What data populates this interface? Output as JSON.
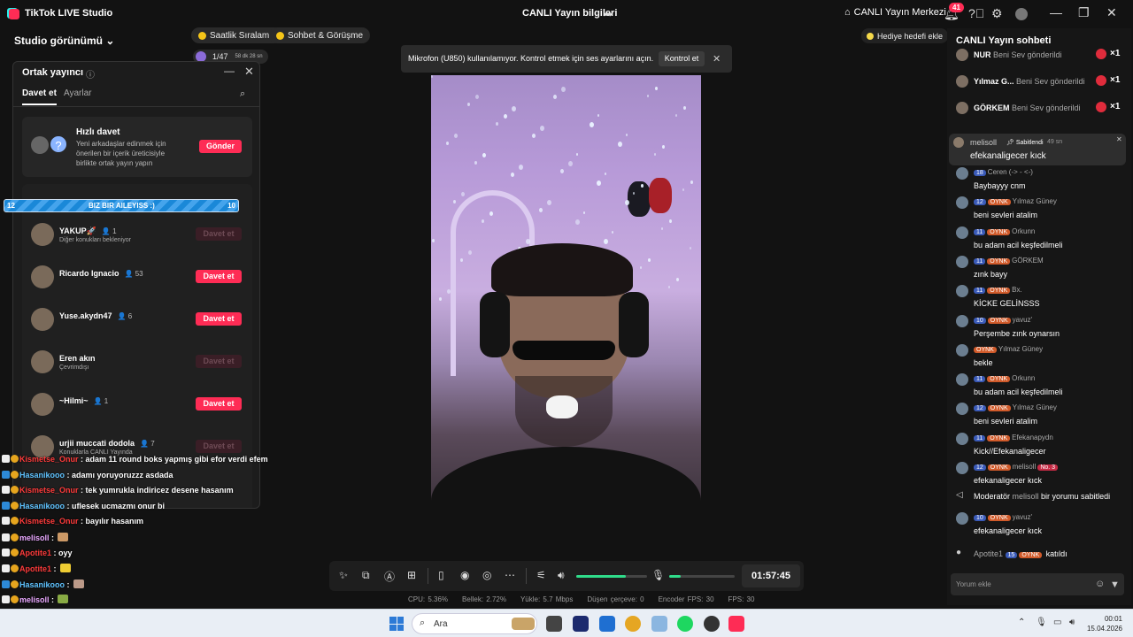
{
  "titlebar": {
    "app_title": "TikTok LIVE Studio",
    "live_info": "CANLI Yayın bilgileri",
    "center": "CANLI Yayın Merkezi",
    "notif_count": "41"
  },
  "top": {
    "studio_view": "Studio görünümü",
    "pills": [
      "Saatlik Sıralama",
      "Sohbet & Görüşme"
    ],
    "viewer_count": "1/47",
    "viewer_time": "58 dk 28 sn",
    "gift_add": "Hediye hedefi ekle"
  },
  "cohost": {
    "title": "Ortak yayıncı",
    "tabs": [
      "Davet et",
      "Ayarlar"
    ],
    "quick_title": "Hızlı davet",
    "quick_desc": "Yeni arkadaşlar edinmek için önerilen bir içerik üreticisiyle birlikte ortak yayın yapın",
    "send": "Gönder",
    "invite_label": "Davet et",
    "rows": [
      {
        "name": "YAKUP🚀",
        "count": "1",
        "sub": "Diğer konukları bekleniyor",
        "enabled": false
      },
      {
        "name": "Ricardo Ignacio",
        "count": "53",
        "sub": "",
        "enabled": true
      },
      {
        "name": "Yuse.akydn47",
        "count": "6",
        "sub": "",
        "enabled": true
      },
      {
        "name": "Eren akın",
        "count": "",
        "sub": "Çevrimdışı",
        "enabled": false
      },
      {
        "name": "~Hilmi~",
        "count": "1",
        "sub": "",
        "enabled": true
      },
      {
        "name": "urjii muccati dodola",
        "count": "7",
        "sub": "Konuklarla CANLI Yayında",
        "enabled": false
      }
    ]
  },
  "banner": {
    "left": "12",
    "center": "BIZ BIR AILEYISS :)",
    "right": "10"
  },
  "overlay_chat": [
    {
      "name": "Kismetse_Onur",
      "text": " : adam 11 round boks yapmış gibi efor verdi efem",
      "color": "red"
    },
    {
      "name": "Hasanikooo",
      "text": " : adamı yoruyoruzzz asdada",
      "color": "blue"
    },
    {
      "name": "Kismetse_Onur",
      "text": " : tek yumrukla indiricez desene hasanım",
      "color": "red"
    },
    {
      "name": "Hasanikooo",
      "text": " : uflesek ucmazmı onur bi",
      "color": "blue"
    },
    {
      "name": "Kismetse_Onur",
      "text": " : bayılır hasanım",
      "color": "red"
    },
    {
      "name": "melisoll",
      "text": " :",
      "color": "pink"
    },
    {
      "name": "Apotite1",
      "text": " : oyy",
      "color": "red"
    },
    {
      "name": "Apotite1",
      "text": " :",
      "color": "red"
    },
    {
      "name": "Hasanikooo",
      "text": " :",
      "color": "blue"
    },
    {
      "name": "melisoll",
      "text": " :",
      "color": "pink"
    }
  ],
  "mic_warning": {
    "text": "Mikrofon (U850) kullanılamıyor. Kontrol etmek için ses ayarlarını açın.",
    "button": "Kontrol et"
  },
  "controls": {
    "volume": 0.7,
    "mic_level": 0.18,
    "timer": "01:57:45"
  },
  "stats": [
    "CPU: 5.36%",
    "Bellek: 2.72%",
    "Yükle: 5.7 Mbps",
    "Düşen çerçeve: 0",
    "Encoder FPS: 30",
    "FPS: 30"
  ],
  "chat": {
    "title": "CANLI Yayın sohbeti",
    "gifts": [
      {
        "name": "NUR",
        "text": "Beni Sev gönderildi",
        "mult": "×1"
      },
      {
        "name": "Yılmaz G...",
        "text": "Beni Sev gönderildi",
        "mult": "×1"
      },
      {
        "name": "GÖRKEM",
        "text": "Beni Sev gönderildi",
        "mult": "×1"
      }
    ],
    "pinned": {
      "name": "melisoll",
      "label": "Sabitlendi",
      "time": "49 sn",
      "text": "efekanaligecer kıck"
    },
    "messages": [
      {
        "lvl": "18",
        "oynk": false,
        "user": "Ceren (-> - <-)",
        "text": "Baybayyy cnm"
      },
      {
        "lvl": "12",
        "oynk": true,
        "user": "Yılmaz Güney",
        "text": "beni sevleri atalim"
      },
      {
        "lvl": "11",
        "oynk": true,
        "user": "Orkunn",
        "text": "bu adam acil keşfedilmeli"
      },
      {
        "lvl": "11",
        "oynk": true,
        "user": "GÖRKEM",
        "text": "zınk bayy"
      },
      {
        "lvl": "11",
        "oynk": true,
        "user": "Bx.",
        "text": "KİCKE GELİNSSS"
      },
      {
        "lvl": "10",
        "oynk": true,
        "user": "yavuz'",
        "text": "Perşembe zınk oynarsın"
      },
      {
        "lvl": "",
        "oynk": true,
        "user": "Yılmaz Güney",
        "text": "bekle"
      },
      {
        "lvl": "11",
        "oynk": true,
        "user": "Orkunn",
        "text": "bu adam acil keşfedilmeli"
      },
      {
        "lvl": "12",
        "oynk": true,
        "user": "Yılmaz Güney",
        "text": "beni sevleri atalim"
      },
      {
        "lvl": "11",
        "oynk": true,
        "user": "Efekanapydn",
        "text": "Kick//Efekanaligecer"
      },
      {
        "lvl": "12",
        "oynk": true,
        "user": "melisoll",
        "text": "efekanaligecer kıck",
        "rank": "No. 3"
      }
    ],
    "moderator": {
      "prefix": "Moderatör",
      "name": "melisoll",
      "text": "bir yorumu sabitledi"
    },
    "msg_after": {
      "lvl": "10",
      "oynk": true,
      "user": "yavuz'",
      "text": "efekanaligecer kıck"
    },
    "joined": {
      "user": "Apotite1",
      "lvl": "15",
      "text": "katıldı"
    },
    "placeholder": "Yorum ekle"
  },
  "taskbar": {
    "search": "Ara",
    "time": "00:01",
    "date": "15.04.2026"
  },
  "colors": {
    "accent": "#fe2c55",
    "level_bar": "#2fdc8a",
    "banner": "#1a88d8"
  }
}
